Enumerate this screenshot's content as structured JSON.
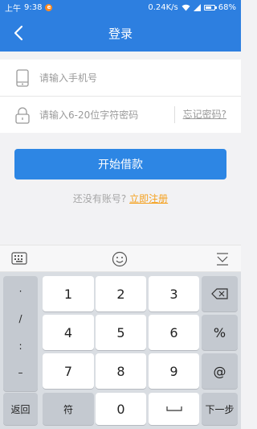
{
  "status_bar": {
    "period": "上午",
    "time": "9:38",
    "notification_badge": "",
    "network_speed": "0.24K/s",
    "battery": "68%"
  },
  "nav": {
    "title": "登录"
  },
  "form": {
    "phone_placeholder": "请输入手机号",
    "password_placeholder": "请输入6-20位字符密码",
    "forgot_label": "忘记密码?"
  },
  "login_button": "开始借款",
  "register": {
    "prompt": "还没有账号?",
    "link": "立即注册"
  },
  "keyboard": {
    "symbols": [
      "·",
      "/",
      ":",
      "–"
    ],
    "digits": [
      "1",
      "2",
      "3",
      "4",
      "5",
      "6",
      "7",
      "8",
      "9",
      "0"
    ],
    "percent": "%",
    "at": "@",
    "back_label": "返回",
    "symbol_label": "符",
    "next_label": "下一步"
  },
  "colors": {
    "brand": "#2d7fe0",
    "button": "#2d86e4",
    "register_link": "#f5a11e"
  }
}
